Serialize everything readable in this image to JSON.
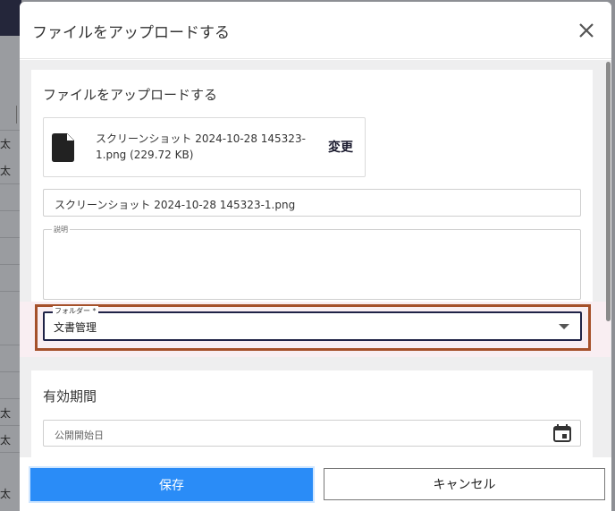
{
  "background": {
    "row_chars": [
      "太",
      "太",
      "太",
      "太",
      "太"
    ]
  },
  "dialog": {
    "title": "ファイルをアップロードする",
    "close_icon": "close-icon"
  },
  "upload_section": {
    "title": "ファイルをアップロードする",
    "file": {
      "icon": "file-icon",
      "name_line1": "スクリーンショット 2024-10-28 145323-",
      "name_line2": "1.png (229.72 KB)",
      "change_label": "変更"
    },
    "filename_field": {
      "value": "スクリーンショット 2024-10-28 145323-1.png"
    },
    "description_field": {
      "label": "説明",
      "value": ""
    },
    "folder_field": {
      "label": "フォルダー *",
      "value": "文書管理",
      "icon": "chevron-down-icon"
    }
  },
  "validity_section": {
    "title": "有効期間",
    "start_date_field": {
      "placeholder": "公開開始日",
      "icon": "calendar-icon"
    }
  },
  "footer": {
    "save_label": "保存",
    "cancel_label": "キャンセル"
  },
  "colors": {
    "primary": "#2a8cf7",
    "highlight_border": "#a5502a",
    "focus_border": "#1f2347",
    "body_bg": "#eeeeef"
  }
}
